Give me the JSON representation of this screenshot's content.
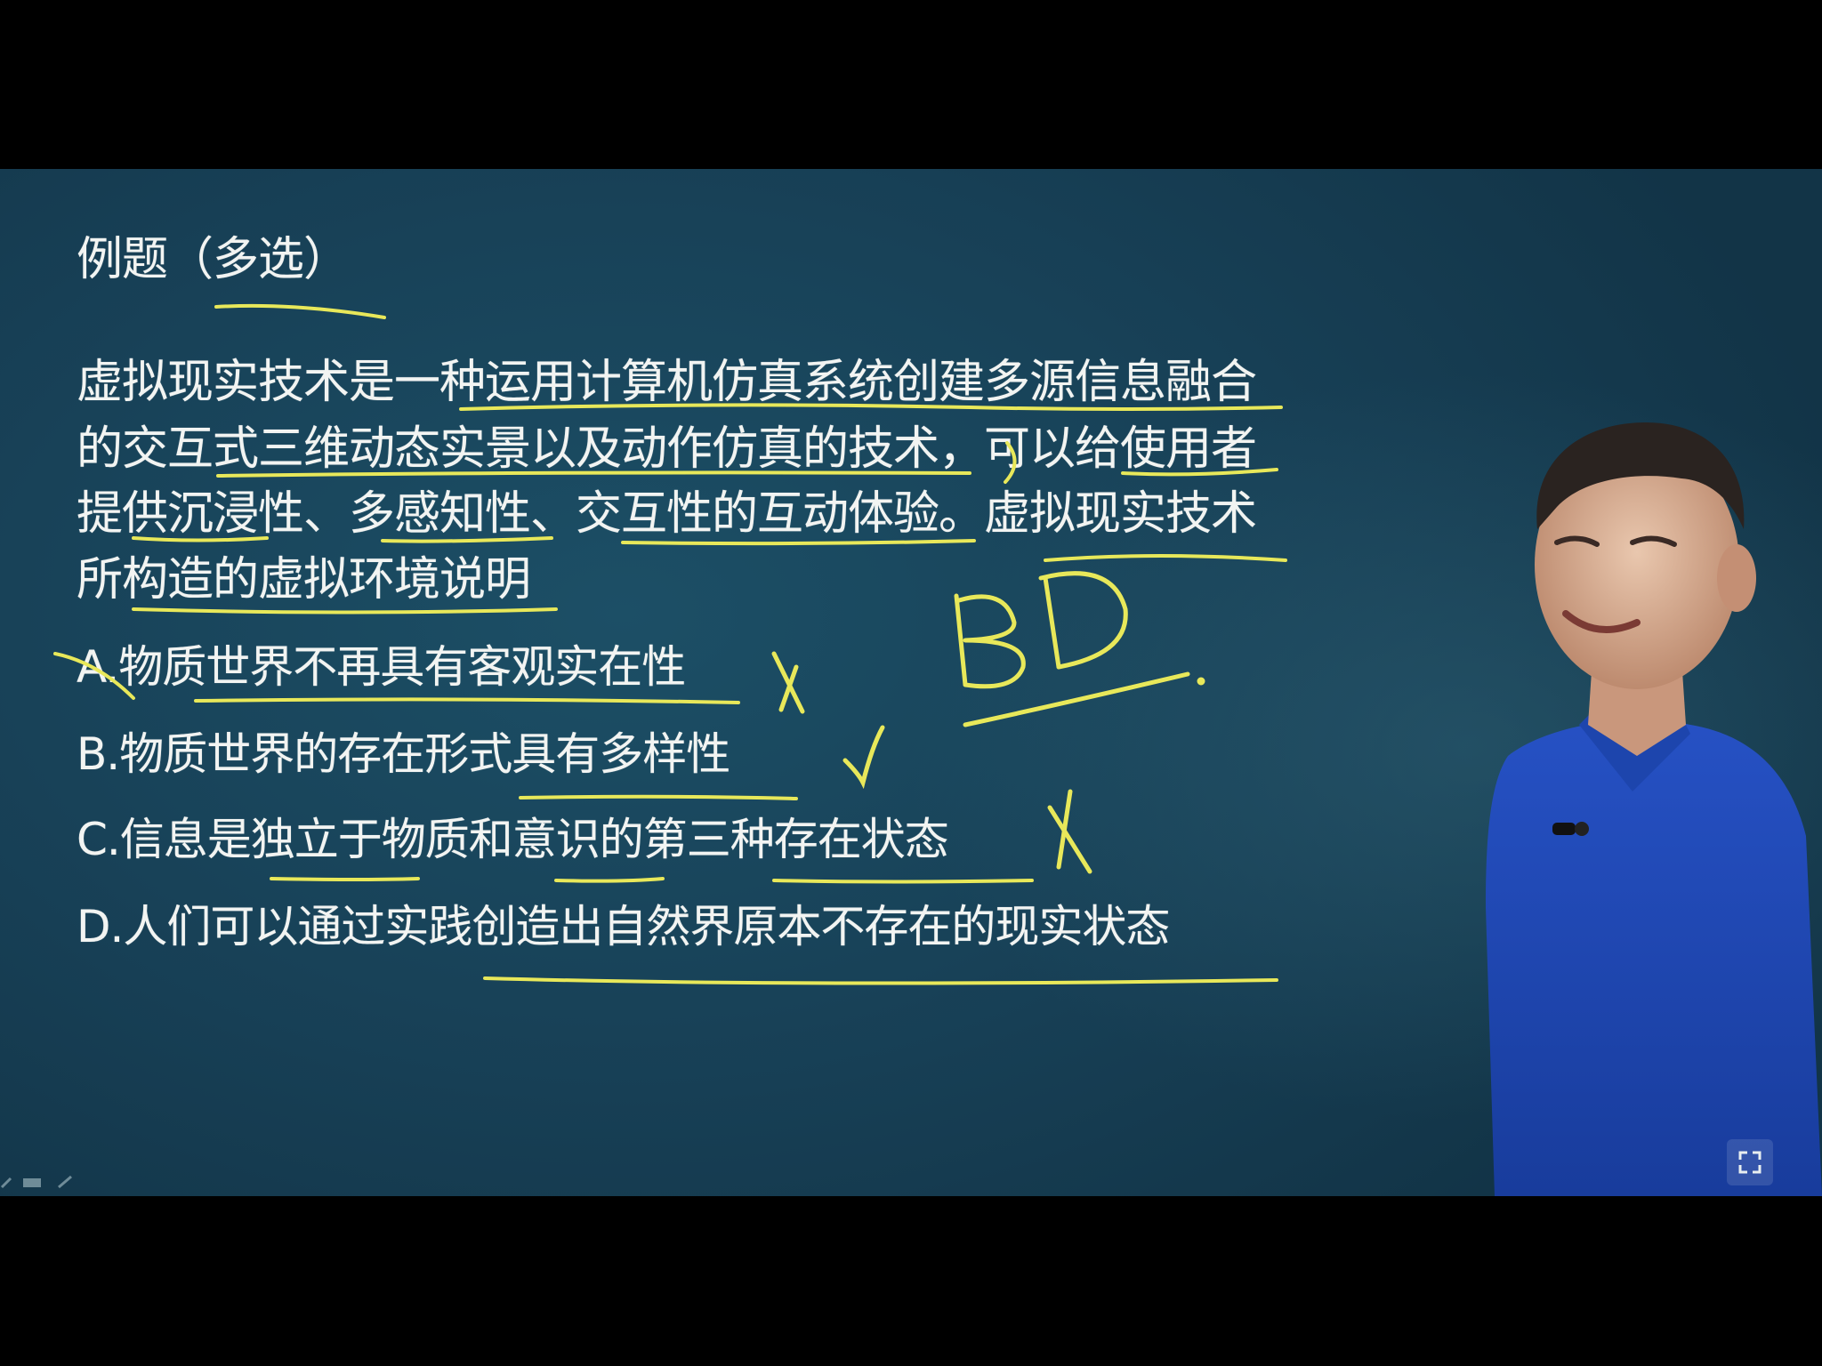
{
  "lesson": {
    "title": "例题（多选）",
    "question_lines": [
      "虚拟现实技术是一种运用计算机仿真系统创建多源信息融合",
      "的交互式三维动态实景以及动作仿真的技术，可以给使用者",
      "提供沉浸性、多感知性、交互性的互动体验。虚拟现实技术",
      "所构造的虚拟环境说明"
    ],
    "options": {
      "A": "A.物质世界不再具有客观实在性",
      "B": "B.物质世界的存在形式具有多样性",
      "C": "C.信息是独立于物质和意识的第三种存在状态",
      "D": "D.人们可以通过实践创造出自然界原本不存在的现实状态"
    },
    "handwritten_answer": "BD"
  },
  "colors": {
    "board": "#1a4a61",
    "chalk_text": "#f2f4f2",
    "ink": "#e8e85a",
    "shirt": "#1f47b8"
  },
  "icons": {
    "player": "fullscreen-icon",
    "wrong_marks": "cross-mark-icon",
    "correct_mark": "check-mark-icon"
  }
}
